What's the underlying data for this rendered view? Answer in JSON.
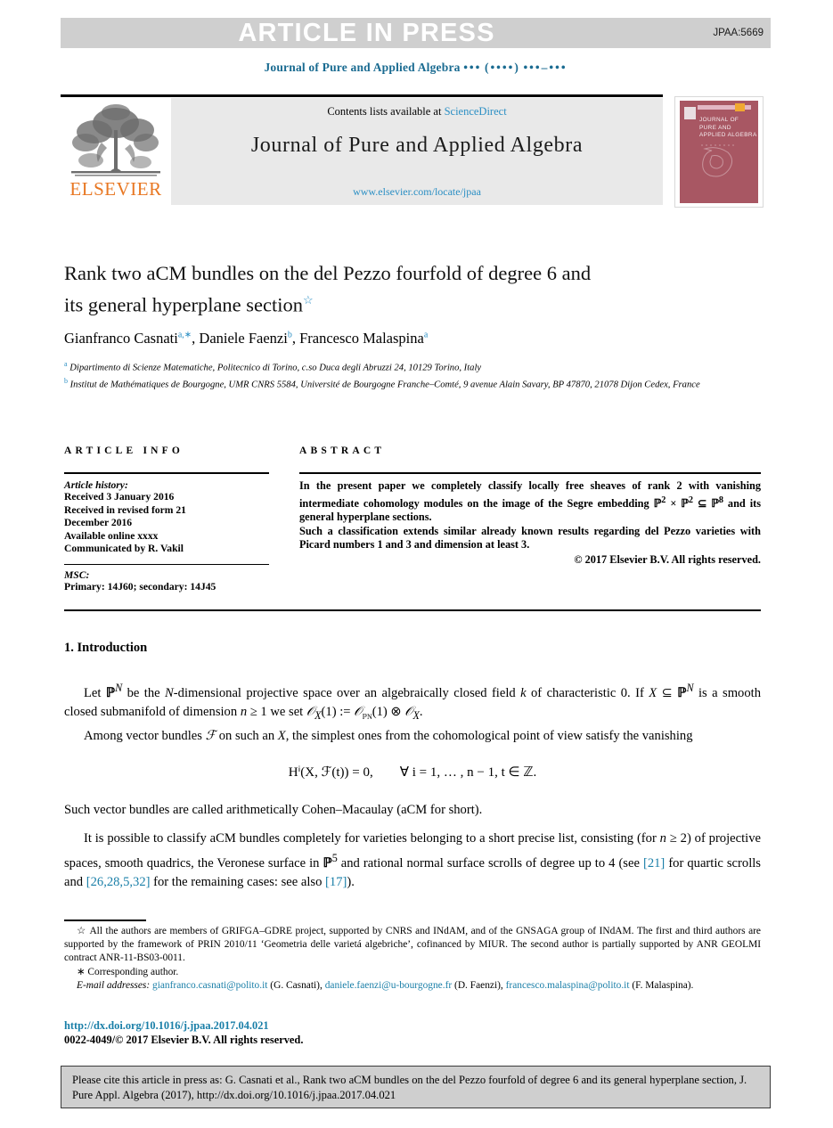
{
  "banner": {
    "text": "ARTICLE IN PRESS",
    "article_code": "JPAA:5669",
    "band_color": "#cfcfcf",
    "text_color": "#ffffff"
  },
  "running_head": {
    "journal": "Journal of Pure and Applied Algebra",
    "volume_placeholder": "•••",
    "year_placeholder": "(••••)",
    "pages_placeholder": "•••–•••",
    "color": "#1a6b91"
  },
  "masthead": {
    "contents_prefix": "Contents lists available at ",
    "contents_link": "ScienceDirect",
    "journal_title": "Journal of Pure and Applied Algebra",
    "journal_url": "www.elsevier.com/locate/jpaa",
    "publisher_logo_text": "ELSEVIER",
    "publisher_logo_color": "#e87722",
    "cover_title_lines": [
      "JOURNAL OF",
      "PURE AND",
      "APPLIED ALGEBRA"
    ],
    "cover_color": "#a85763",
    "link_color": "#2b8fc4"
  },
  "article": {
    "title_line1": "Rank two aCM bundles on the del Pezzo fourfold of degree 6 and",
    "title_line2": "its general hyperplane section",
    "title_footnote_marker": "☆",
    "authors": [
      {
        "name": "Gianfranco Casnati",
        "marks": "a,∗"
      },
      {
        "name": "Daniele Faenzi",
        "marks": "b"
      },
      {
        "name": "Francesco Malaspina",
        "marks": "a"
      }
    ],
    "affiliations": [
      {
        "mark": "a",
        "text": "Dipartimento di Scienze Matematiche, Politecnico di Torino, c.so Duca degli Abruzzi 24, 10129 Torino, Italy"
      },
      {
        "mark": "b",
        "text": "Institut de Mathématiques de Bourgogne, UMR CNRS 5584, Université de Bourgogne Franche–Comté, 9 avenue Alain Savary, BP 47870, 21078 Dijon Cedex, France"
      }
    ]
  },
  "article_info": {
    "heading": "ARTICLE INFO",
    "history_label": "Article history:",
    "history_lines": [
      "Received 3 January 2016",
      "Received in revised form 21",
      "December 2016",
      "Available online xxxx",
      "Communicated by R. Vakil"
    ],
    "msc_label": "MSC:",
    "msc_value": "Primary: 14J60; secondary: 14J45"
  },
  "abstract": {
    "heading": "ABSTRACT",
    "paragraph1_a": "In the present paper we completely classify locally free sheaves of rank 2 with vanishing intermediate cohomology modules on the image of the Segre embedding ",
    "math_p2a": "ℙ",
    "math_exp2a": "2",
    "math_times": " × ",
    "math_p2b": "ℙ",
    "math_exp2b": "2",
    "math_subset": " ⊆ ",
    "math_p8": "ℙ",
    "math_exp8": "8",
    "paragraph1_b": " and its general hyperplane sections.",
    "paragraph2": "Such a classification extends similar already known results regarding del Pezzo varieties with Picard numbers 1 and 3 and dimension at least 3.",
    "copyright": "© 2017 Elsevier B.V. All rights reserved."
  },
  "body": {
    "section_number_title": "1. Introduction",
    "p1_part1": "Let ",
    "p1_pn": "ℙ",
    "p1_pn_exp": "N",
    "p1_part2": " be the ",
    "p1_n": "N",
    "p1_part3": "-dimensional projective space over an algebraically closed field ",
    "p1_k": "k",
    "p1_part4": " of characteristic 0. If ",
    "p1_x": "X",
    "p1_subset": " ⊆ ",
    "p1_part5": " is a smooth closed submanifold of dimension ",
    "p1_n2": "n",
    "p1_part6": " ≥ 1 we set ",
    "p1_ox": "𝒪",
    "p1_ox_sub": "X",
    "p1_part7": "(1) := ",
    "p1_opn": "𝒪",
    "p1_opn_sub": "ℙN",
    "p1_part8": "(1) ⊗ ",
    "p1_ox2": "𝒪",
    "p1_ox2_sub": "X",
    "p1_end": ".",
    "p2_part1": "Among vector bundles ",
    "p2_f": "ℱ",
    "p2_part2": " on such an ",
    "p2_x": "X",
    "p2_part3": ", the simplest ones from the cohomological point of view satisfy the vanishing",
    "equation": "Hⁱ(X, ℱ(t)) = 0,  ∀ i = 1, … , n − 1, t ∈ ℤ.",
    "p3": "Such vector bundles are called arithmetically Cohen–Macaulay (aCM for short).",
    "p4_part1": "It is possible to classify aCM bundles completely for varieties belonging to a short precise list, consisting (for ",
    "p4_n": "n",
    "p4_part2": " ≥ 2) of projective spaces, smooth quadrics, the Veronese surface in ",
    "p4_p5": "ℙ",
    "p4_p5_exp": "5",
    "p4_part3": " and rational normal surface scrolls of degree up to 4 (see ",
    "p4_cite1": "[21]",
    "p4_part4": " for quartic scrolls and ",
    "p4_cite2": "[26,28,5,32]",
    "p4_part5": " for the remaining cases: see also ",
    "p4_cite3": "[17]",
    "p4_end": ")."
  },
  "footnotes": {
    "star_marker": "☆",
    "star_text": "All the authors are members of GRIFGA–GDRE project, supported by CNRS and INdAM, and of the GNSAGA group of INdAM. The first and third authors are supported by the framework of PRIN 2010/11 ‘Geometria delle varietá algebriche’, cofinanced by MIUR. The second author is partially supported by ANR GEOLMI contract ANR-11-BS03-0011.",
    "corresponding_marker": "∗",
    "corresponding_text": "Corresponding author.",
    "emails_label": "E-mail addresses:",
    "emails": [
      {
        "address": "gianfranco.casnati@polito.it",
        "person": "(G. Casnati),"
      },
      {
        "address": "daniele.faenzi@u-bourgogne.fr",
        "person": "(D. Faenzi),"
      },
      {
        "address": "francesco.malaspina@polito.it",
        "person": "(F. Malaspina)."
      }
    ],
    "link_color": "#1a7fa8"
  },
  "imprint": {
    "doi_url": "http://dx.doi.org/10.1016/j.jpaa.2017.04.021",
    "issn_copyright": "0022-4049/© 2017 Elsevier B.V. All rights reserved."
  },
  "cite_box": {
    "line1": "Please cite this article in press as: G. Casnati et al., Rank two aCM bundles on the del Pezzo fourfold of degree 6 and its",
    "line2": "general hyperplane section, J. Pure Appl. Algebra (2017), http://dx.doi.org/10.1016/j.jpaa.2017.04.021",
    "background": "#cfcfcf"
  }
}
